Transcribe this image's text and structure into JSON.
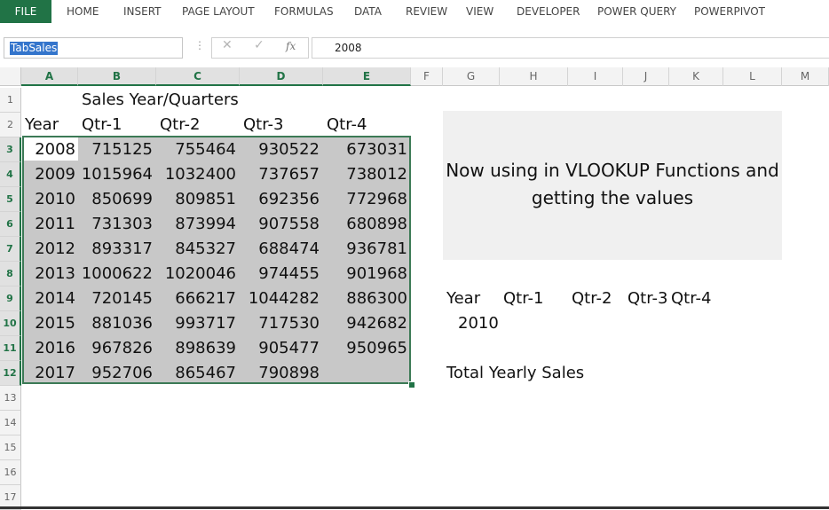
{
  "ribbon": {
    "tabs": [
      "FILE",
      "HOME",
      "INSERT",
      "PAGE LAYOUT",
      "FORMULAS",
      "DATA",
      "REVIEW",
      "VIEW",
      "DEVELOPER",
      "POWER QUERY",
      "POWERPIVOT"
    ]
  },
  "formula_bar": {
    "name_box": "TabSales",
    "cancel_icon": "✕",
    "enter_icon": "✓",
    "fx_label": "fx",
    "value": "2008"
  },
  "columns": [
    "A",
    "B",
    "C",
    "D",
    "E",
    "F",
    "G",
    "H",
    "I",
    "J",
    "K",
    "L",
    "M"
  ],
  "rows": [
    "1",
    "2",
    "3",
    "4",
    "5",
    "6",
    "7",
    "8",
    "9",
    "10",
    "11",
    "12",
    "13",
    "14",
    "15",
    "16",
    "17"
  ],
  "table": {
    "title": "Sales Year/Quarters",
    "headers": [
      "Year",
      "Qtr-1",
      "Qtr-2",
      "Qtr-3",
      "Qtr-4"
    ],
    "rows": [
      [
        "2008",
        "715125",
        "755464",
        "930522",
        "673031"
      ],
      [
        "2009",
        "1015964",
        "1032400",
        "737657",
        "738012"
      ],
      [
        "2010",
        "850699",
        "809851",
        "692356",
        "772968"
      ],
      [
        "2011",
        "731303",
        "873994",
        "907558",
        "680898"
      ],
      [
        "2012",
        "893317",
        "845327",
        "688474",
        "936781"
      ],
      [
        "2013",
        "1000622",
        "1020046",
        "974455",
        "901968"
      ],
      [
        "2014",
        "720145",
        "666217",
        "1044282",
        "886300"
      ],
      [
        "2015",
        "881036",
        "993717",
        "717530",
        "942682"
      ],
      [
        "2016",
        "967826",
        "898639",
        "905477",
        "950965"
      ],
      [
        "2017",
        "952706",
        "865467",
        "790898",
        ""
      ]
    ]
  },
  "callout": {
    "line1": "Now using in VLOOKUP Functions and",
    "line2": "getting the values"
  },
  "lookup": {
    "headers": [
      "Year",
      "Qtr-1",
      "Qtr-2",
      "Qtr-3",
      "Qtr-4"
    ],
    "year_value": "2010",
    "total_label": "Total Yearly Sales"
  },
  "colors": {
    "accent": "#217346",
    "selection_fill": "#c8c8c8",
    "name_box_highlight": "#3475cc"
  }
}
